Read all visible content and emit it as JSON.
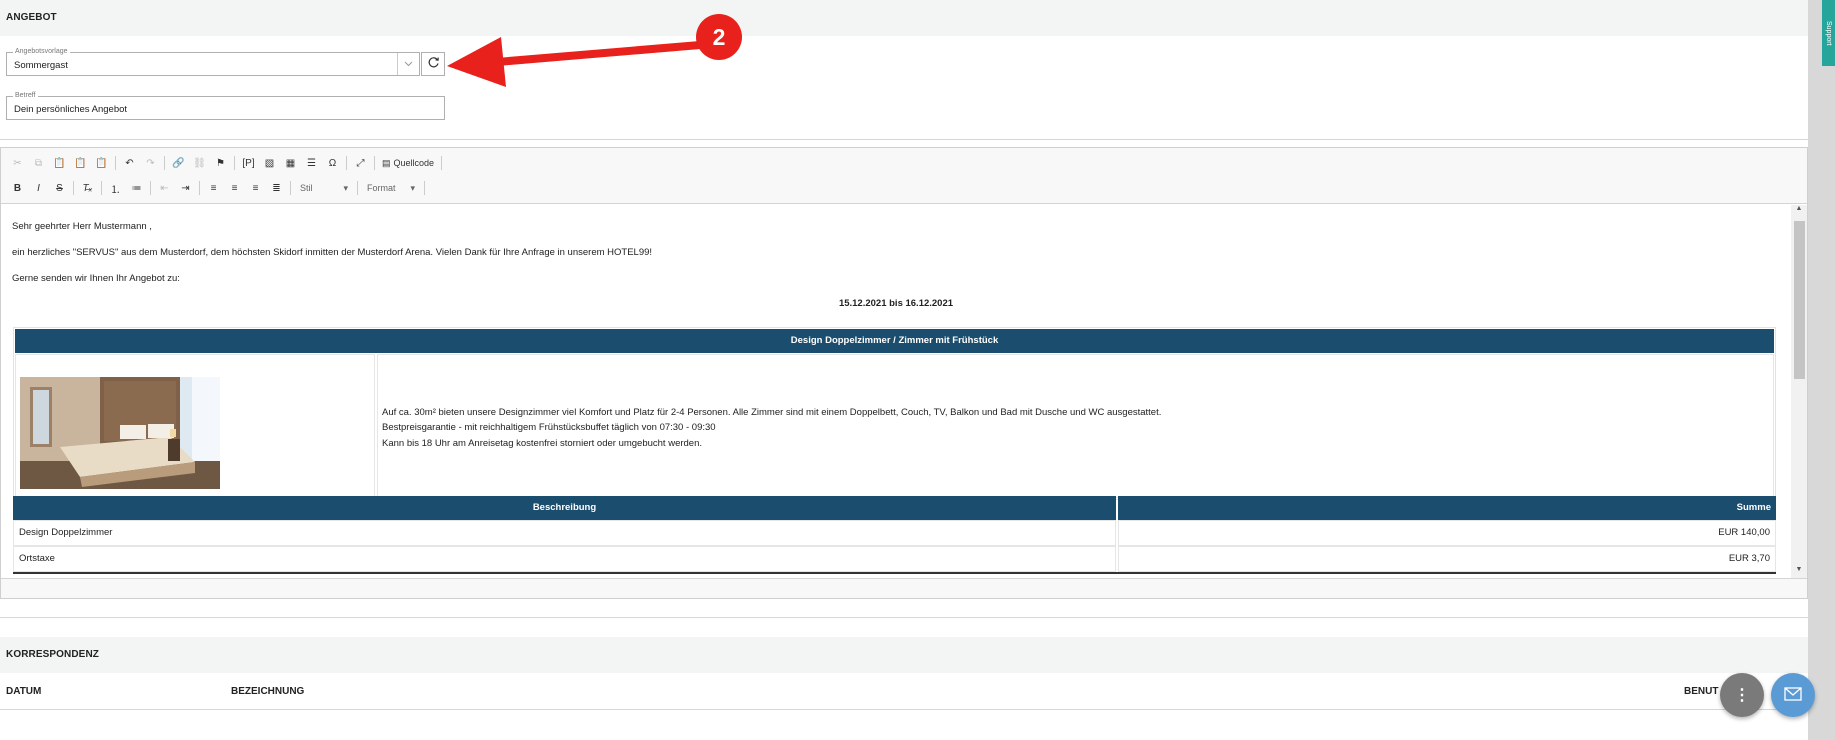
{
  "offer_section": {
    "title": "ANGEBOT"
  },
  "template_field": {
    "label": "Angebotsvorlage",
    "value": "Sommergast"
  },
  "subject_field": {
    "label": "Betreff",
    "value": "Dein persönliches Angebot"
  },
  "annotation": {
    "step_number": "2",
    "color": "#e8211c"
  },
  "toolbar": {
    "source_label": "Quellcode",
    "style_combo": "Stil",
    "format_combo": "Format"
  },
  "letter": {
    "greeting": "Sehr geehrter Herr Mustermann ,",
    "intro": "ein herzliches \"SERVUS\" aus dem Musterdorf, dem höchsten Skidorf inmitten der Musterdorf Arena. Vielen Dank für Ihre Anfrage in unserem HOTEL99!",
    "offer_intro": "Gerne senden wir Ihnen Ihr Angebot zu:",
    "date_range": "15.12.2021 bis 16.12.2021"
  },
  "room": {
    "header": "Design Doppelzimmer / Zimmer mit Frühstück",
    "desc_line1": "Auf ca. 30m² bieten unsere Designzimmer viel Komfort und Platz für 2-4 Personen. Alle Zimmer sind mit einem Doppelbett, Couch, TV, Balkon und Bad mit Dusche und WC ausgestattet.",
    "desc_line2": "Bestpreisgarantie - mit reichhaltigem Frühstücksbuffet täglich von 07:30 - 09:30",
    "desc_line3": "Kann bis 18 Uhr am Anreisetag kostenfrei storniert oder umgebucht werden."
  },
  "price_table": {
    "col_description": "Beschreibung",
    "col_sum": "Summe",
    "rows": [
      {
        "description": "Design Doppelzimmer",
        "sum": "EUR 140,00"
      },
      {
        "description": "Ortstaxe",
        "sum": "EUR 3,70"
      }
    ]
  },
  "correspondence": {
    "title": "KORRESPONDENZ",
    "col_date": "DATUM",
    "col_name": "BEZEICHNUNG",
    "col_user": "BENUT"
  },
  "side_tab": {
    "label": "Support"
  },
  "colors": {
    "table_header": "#1b4d6e",
    "fab_grey": "#7a7a7a",
    "fab_blue": "#5b9bd5",
    "side_tab": "#26a69a"
  }
}
